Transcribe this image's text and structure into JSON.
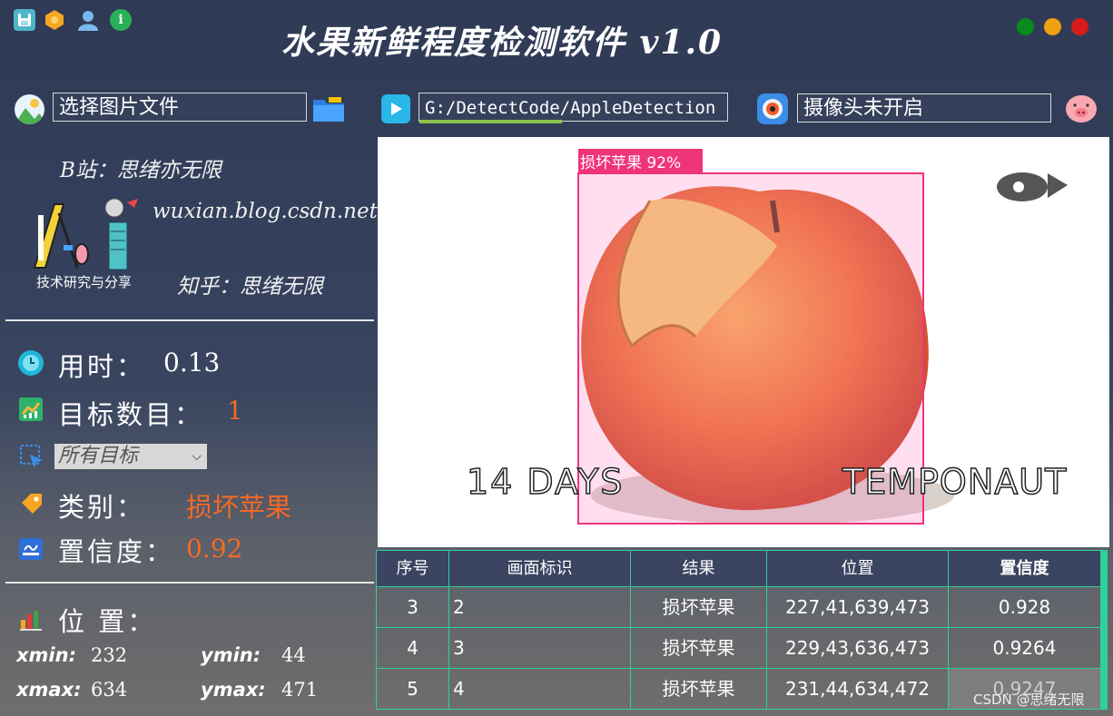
{
  "app": {
    "title": "水果新鲜程度检测软件 v1.0"
  },
  "toolbar": {
    "icons": [
      "save-icon",
      "hexagon-icon",
      "user-icon",
      "info-icon"
    ],
    "window_colors": {
      "green": "#0a8a1a",
      "yellow": "#f0a010",
      "red": "#d81b1b"
    }
  },
  "inputs": {
    "image_file": "选择图片文件",
    "video_path": "G:/DetectCode/AppleDetection",
    "camera": "摄像头未开启"
  },
  "credits": {
    "bilibili": "B站：思绪亦无限",
    "blog": "wuxian.blog.csdn.net",
    "zhihu": "知乎：思绪无限",
    "logo_caption": "技术研究与分享"
  },
  "stats": {
    "time_label": "用时：",
    "time_value": "0.13",
    "count_label": "目标数目：",
    "count_value": "1",
    "target_select": "所有目标",
    "class_label": "类别：",
    "class_value": "损坏苹果",
    "conf_label": "置信度：",
    "conf_value": "0.92",
    "position_label": "位 置：",
    "xmin_label": "xmin:",
    "xmin_value": "232",
    "ymin_label": "ymin:",
    "ymin_value": "44",
    "xmax_label": "xmax:",
    "xmax_value": "634",
    "ymax_label": "ymax:",
    "ymax_value": "471"
  },
  "image": {
    "detection_label": "损坏苹果 92%",
    "text_left": "14 DAYS",
    "text_right": "TEMPONAUT"
  },
  "table": {
    "headers": [
      "序号",
      "画面标识",
      "结果",
      "位置",
      "置信度"
    ],
    "rows": [
      [
        "3",
        "2",
        "损坏苹果",
        "227,41,639,473",
        "0.928"
      ],
      [
        "4",
        "3",
        "损坏苹果",
        "229,43,636,473",
        "0.9264"
      ],
      [
        "5",
        "4",
        "损坏苹果",
        "231,44,634,472",
        "0.9247"
      ]
    ]
  },
  "watermark": "CSDN @思绪无限",
  "colors": {
    "accent_green": "#2ed19a",
    "value_orange": "#f26a24",
    "box_pink": "#f0347a"
  }
}
